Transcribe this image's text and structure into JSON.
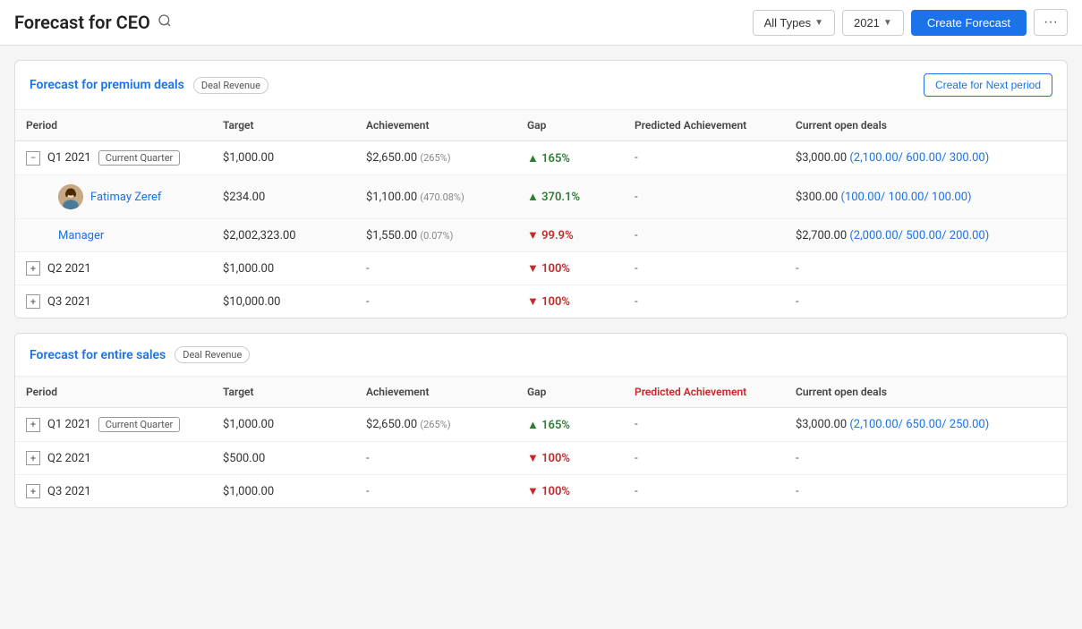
{
  "header": {
    "title": "Forecast for CEO",
    "search_icon": "🔍",
    "all_types_label": "All Types",
    "year_label": "2021",
    "create_btn_label": "Create Forecast",
    "more_icon": "···"
  },
  "sections": [
    {
      "id": "premium",
      "title": "Forecast for premium deals",
      "badge": "Deal Revenue",
      "create_next_btn": "Create for Next period",
      "columns": [
        "Period",
        "Target",
        "Achievement",
        "Gap",
        "Predicted Achievement",
        "Current open deals"
      ],
      "rows": [
        {
          "type": "quarter_expanded",
          "expand": "minus",
          "period": "Q1 2021",
          "is_current": true,
          "current_label": "Current Quarter",
          "target": "$1,000.00",
          "achievement": "$2,650.00",
          "achievement_pct": "(265%)",
          "gap_dir": "up",
          "gap": "165%",
          "predicted": "-",
          "open_deals": "$3,000.00",
          "open_deals_detail": "(2,100.00/ 600.00/ 300.00)"
        },
        {
          "type": "sub_person",
          "expand": "none",
          "period": "Fatimay Zeref",
          "is_current": false,
          "target": "$234.00",
          "achievement": "$1,100.00",
          "achievement_pct": "(470.08%)",
          "gap_dir": "up",
          "gap": "370.1%",
          "predicted": "-",
          "open_deals": "$300.00",
          "open_deals_detail": "(100.00/ 100.00/ 100.00)"
        },
        {
          "type": "sub_manager",
          "expand": "none",
          "period": "Manager",
          "is_current": false,
          "target": "$2,002,323.00",
          "achievement": "$1,550.00",
          "achievement_pct": "(0.07%)",
          "gap_dir": "down",
          "gap": "99.9%",
          "predicted": "-",
          "open_deals": "$2,700.00",
          "open_deals_detail": "(2,000.00/ 500.00/ 200.00)"
        },
        {
          "type": "quarter",
          "expand": "plus",
          "period": "Q2 2021",
          "is_current": false,
          "target": "$1,000.00",
          "achievement": "-",
          "achievement_pct": "",
          "gap_dir": "down",
          "gap": "100%",
          "predicted": "-",
          "open_deals": "-"
        },
        {
          "type": "quarter",
          "expand": "plus",
          "period": "Q3 2021",
          "is_current": false,
          "target": "$10,000.00",
          "achievement": "-",
          "achievement_pct": "",
          "gap_dir": "down",
          "gap": "100%",
          "predicted": "-",
          "open_deals": "-"
        }
      ]
    },
    {
      "id": "entire",
      "title": "Forecast for entire sales",
      "badge": "Deal Revenue",
      "create_next_btn": null,
      "columns": [
        "Period",
        "Target",
        "Achievement",
        "Gap",
        "Predicted Achievement",
        "Current open deals"
      ],
      "rows": [
        {
          "type": "quarter",
          "expand": "plus",
          "period": "Q1 2021",
          "is_current": true,
          "current_label": "Current Quarter",
          "target": "$1,000.00",
          "achievement": "$2,650.00",
          "achievement_pct": "(265%)",
          "gap_dir": "up",
          "gap": "165%",
          "predicted": "-",
          "open_deals": "$3,000.00",
          "open_deals_detail": "(2,100.00/ 650.00/ 250.00)"
        },
        {
          "type": "quarter",
          "expand": "plus",
          "period": "Q2 2021",
          "is_current": false,
          "target": "$500.00",
          "achievement": "-",
          "achievement_pct": "",
          "gap_dir": "down",
          "gap": "100%",
          "predicted": "-",
          "open_deals": "-"
        },
        {
          "type": "quarter",
          "expand": "plus",
          "period": "Q3 2021",
          "is_current": false,
          "target": "$1,000.00",
          "achievement": "-",
          "achievement_pct": "",
          "gap_dir": "down",
          "gap": "100%",
          "predicted": "-",
          "open_deals": "-"
        }
      ]
    }
  ]
}
